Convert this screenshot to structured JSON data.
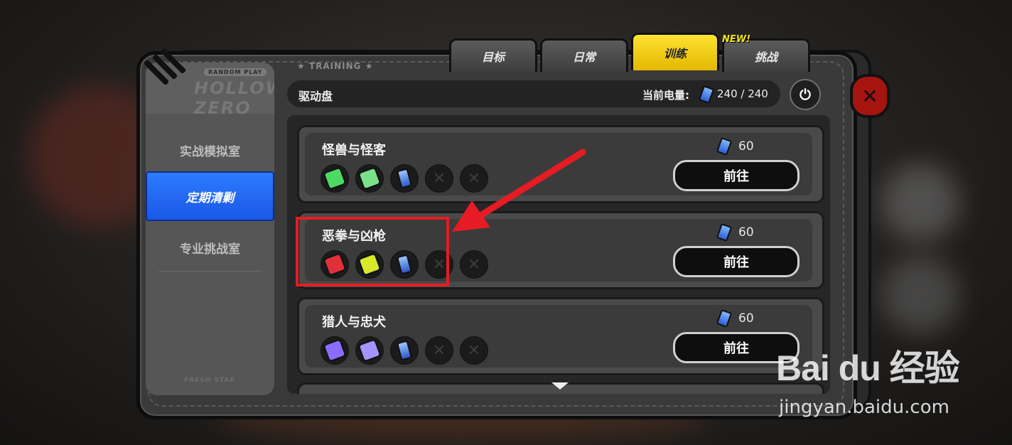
{
  "tabs": [
    {
      "label": "目标",
      "active": false
    },
    {
      "label": "日常",
      "active": false
    },
    {
      "label": "训练",
      "active": true
    },
    {
      "label": "挑战",
      "active": false
    }
  ],
  "new_badge": "NEW!",
  "sidebar": {
    "logo_chip": "RANDOM PLAY",
    "logo_text": "HOLLOW ZERO",
    "items": [
      {
        "label": "实战模拟室",
        "active": false
      },
      {
        "label": "定期清剿",
        "active": true
      },
      {
        "label": "专业挑战室",
        "active": false
      }
    ],
    "footer": "FRESH STAR"
  },
  "section_label": "★ TRAINING ★",
  "header": {
    "title": "驱动盘",
    "energy_label": "当前电量:",
    "energy_value": "240 / 240"
  },
  "cards": [
    {
      "title": "怪兽与怪客",
      "cost": "60",
      "button": "前往",
      "icons": [
        "green-disc-icon",
        "green-disc-icon",
        "battery-icon",
        "locked-slot-icon",
        "locked-slot-icon"
      ]
    },
    {
      "title": "恶拳与凶枪",
      "cost": "60",
      "button": "前往",
      "icons": [
        "red-disc-icon",
        "yellow-disc-icon",
        "battery-icon",
        "locked-slot-icon",
        "locked-slot-icon"
      ]
    },
    {
      "title": "猎人与忠犬",
      "cost": "60",
      "button": "前往",
      "icons": [
        "purple-disc-icon",
        "purple-disc-icon",
        "battery-icon",
        "locked-slot-icon",
        "locked-slot-icon"
      ]
    }
  ],
  "colors": {
    "active_tab": "#f5cf10",
    "active_sidebar": "#1f66f0",
    "close_button": "#a5140f",
    "highlight": "#e51c23",
    "disc_green": "#4cd964",
    "disc_red": "#e0303a",
    "disc_yellow": "#d8e82a",
    "disc_purple": "#8a6cff"
  },
  "watermark": {
    "main": "Bai du 经验",
    "sub": "jingyan.baidu.com"
  }
}
